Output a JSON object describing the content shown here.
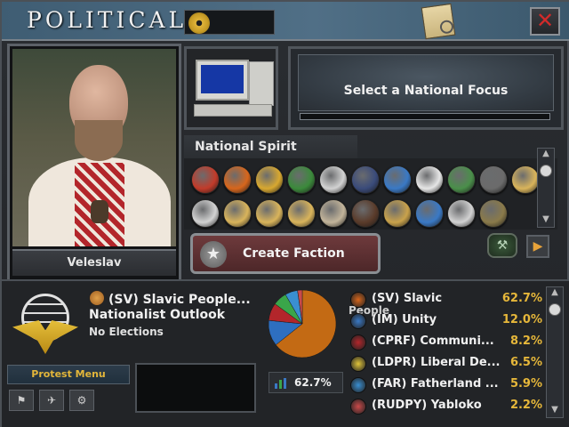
{
  "header": {
    "title": "POLITICAL",
    "ideology_icon": "radiation-icon",
    "map_icon": "map-magnifier-icon",
    "close_icon": "close-icon",
    "close_label": "✕"
  },
  "leader": {
    "name": "Veleslav"
  },
  "focus": {
    "label": "Select a National Focus",
    "progress": 0
  },
  "spirits": {
    "title": "National Spirit",
    "items": [
      {
        "color": "#c23b2a"
      },
      {
        "color": "#d7661c"
      },
      {
        "color": "#d8a830"
      },
      {
        "color": "#3b8a3b"
      },
      {
        "color": "#d2d2d2"
      },
      {
        "color": "#3a4b7a"
      },
      {
        "color": "#3a79c5"
      },
      {
        "color": "#e6e6e6"
      },
      {
        "color": "#4a8f4a"
      },
      {
        "color": "#6b6b6b"
      },
      {
        "color": "#d9b45b"
      },
      {
        "color": "#d2d2d2"
      },
      {
        "color": "#d9b45b"
      },
      {
        "color": "#d9b45b"
      },
      {
        "color": "#d9b45b"
      },
      {
        "color": "#c2b49a"
      },
      {
        "color": "#5a3b2a"
      },
      {
        "color": "#c9a24b"
      },
      {
        "color": "#3a79c5"
      },
      {
        "color": "#d2d2d2"
      },
      {
        "color": "#8a7a4a"
      }
    ]
  },
  "faction": {
    "label": "Create Faction",
    "star_icon": "star-icon",
    "decision_icon": "crossed-hammers-icon",
    "arrow_icon": "arrow-right-icon"
  },
  "government": {
    "party": "(SV) Slavic People...",
    "outlook": "Nationalist Outlook",
    "elections": "No Elections"
  },
  "protest": {
    "label": "Protest Menu"
  },
  "popularity": {
    "display": "62.7%"
  },
  "parties": [
    {
      "name": "(SV) Slavic",
      "sub": "People",
      "pct": "62.7%",
      "color": "#d7661c",
      "share": 62.7
    },
    {
      "name": "(IM) Unity",
      "pct": "12.0%",
      "color": "#3a79c5",
      "share": 12.0
    },
    {
      "name": "(CPRF) Communi...",
      "pct": "8.2%",
      "color": "#b3262b",
      "share": 8.2
    },
    {
      "name": "(LDPR) Liberal De...",
      "pct": "6.5%",
      "color": "#e0c43a",
      "share": 6.5
    },
    {
      "name": "(FAR) Fatherland ...",
      "pct": "5.9%",
      "color": "#3a8fd1",
      "share": 5.9
    },
    {
      "name": "(RUDPY) Yabloko",
      "pct": "2.2%",
      "color": "#c94a4a",
      "share": 2.2
    }
  ],
  "colors": {
    "pie_main": "#c36a14",
    "pie_green": "#3aa64a",
    "pie_blue": "#2e6fc0",
    "gold": "#e6b73a"
  }
}
